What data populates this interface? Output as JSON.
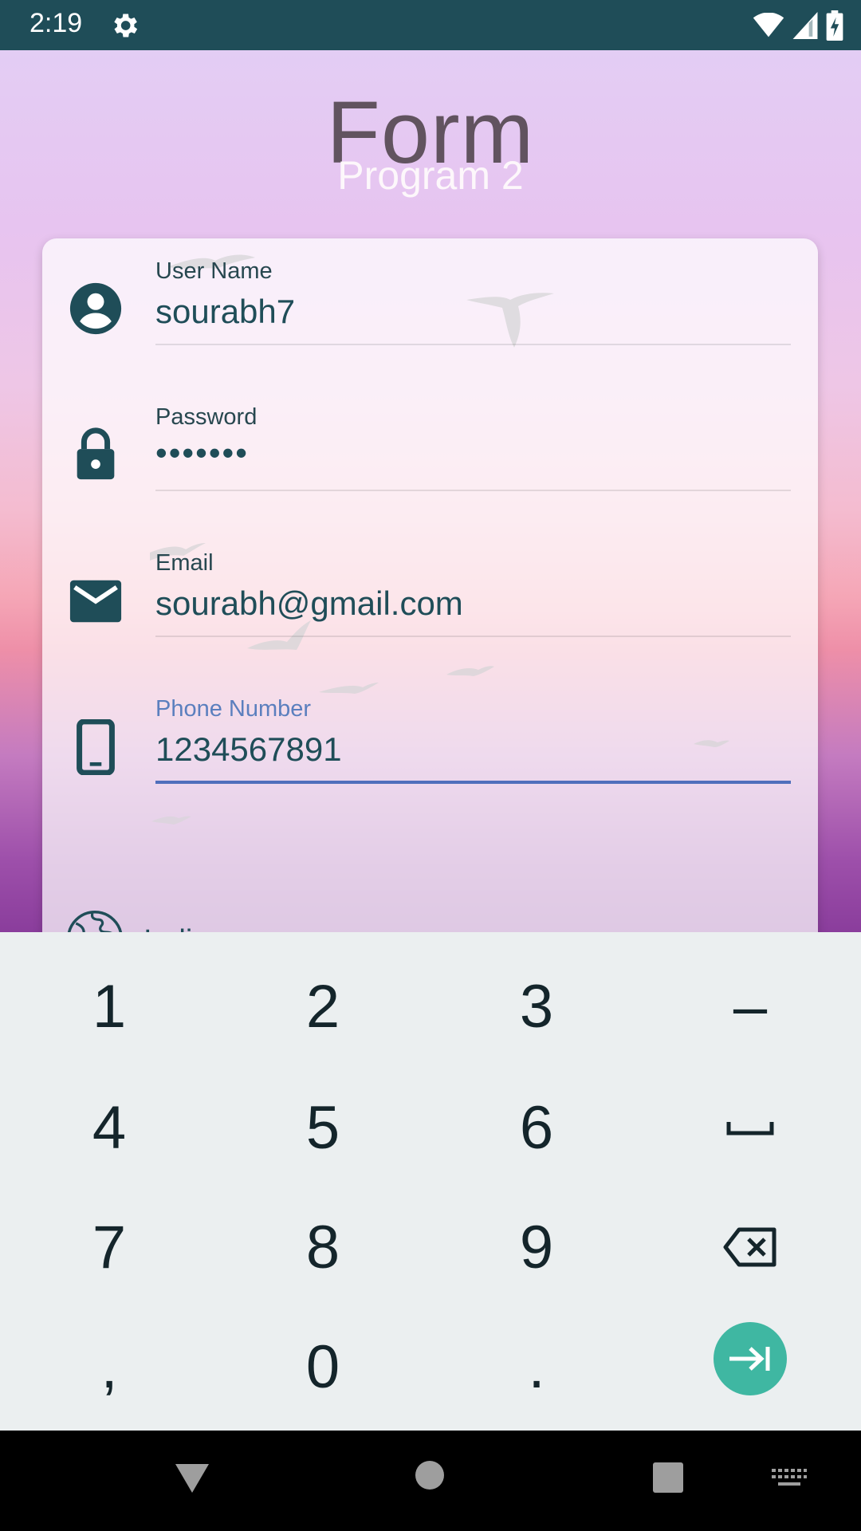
{
  "status_bar": {
    "time": "2:19",
    "icons": [
      "settings-icon",
      "wifi-icon",
      "signal-icon",
      "battery-icon"
    ]
  },
  "header": {
    "title": "Form",
    "subtitle": "Program 2"
  },
  "form": {
    "username": {
      "label": "User Name",
      "value": "sourabh7",
      "icon": "account-circle-icon"
    },
    "password": {
      "label": "Password",
      "value": "•••••••",
      "icon": "lock-icon"
    },
    "email": {
      "label": "Email",
      "value": "sourabh@gmail.com",
      "icon": "email-icon"
    },
    "phone": {
      "label": "Phone Number",
      "value": "1234567891",
      "icon": "phone-icon",
      "focused": true
    },
    "country": {
      "value": "India",
      "icon": "globe-icon"
    }
  },
  "keyboard": {
    "rows": [
      [
        "1",
        "2",
        "3",
        "–"
      ],
      [
        "4",
        "5",
        "6",
        "space"
      ],
      [
        "7",
        "8",
        "9",
        "backspace"
      ],
      [
        ",",
        "0",
        ".",
        "next"
      ]
    ]
  },
  "colors": {
    "status_bar": "#1f4d58",
    "accent": "#4f6fbc",
    "enter_key": "#3fb7a2"
  },
  "nav_bar": {
    "buttons": [
      "back-icon",
      "home-icon",
      "recents-icon",
      "keyboard-switch-icon"
    ]
  }
}
